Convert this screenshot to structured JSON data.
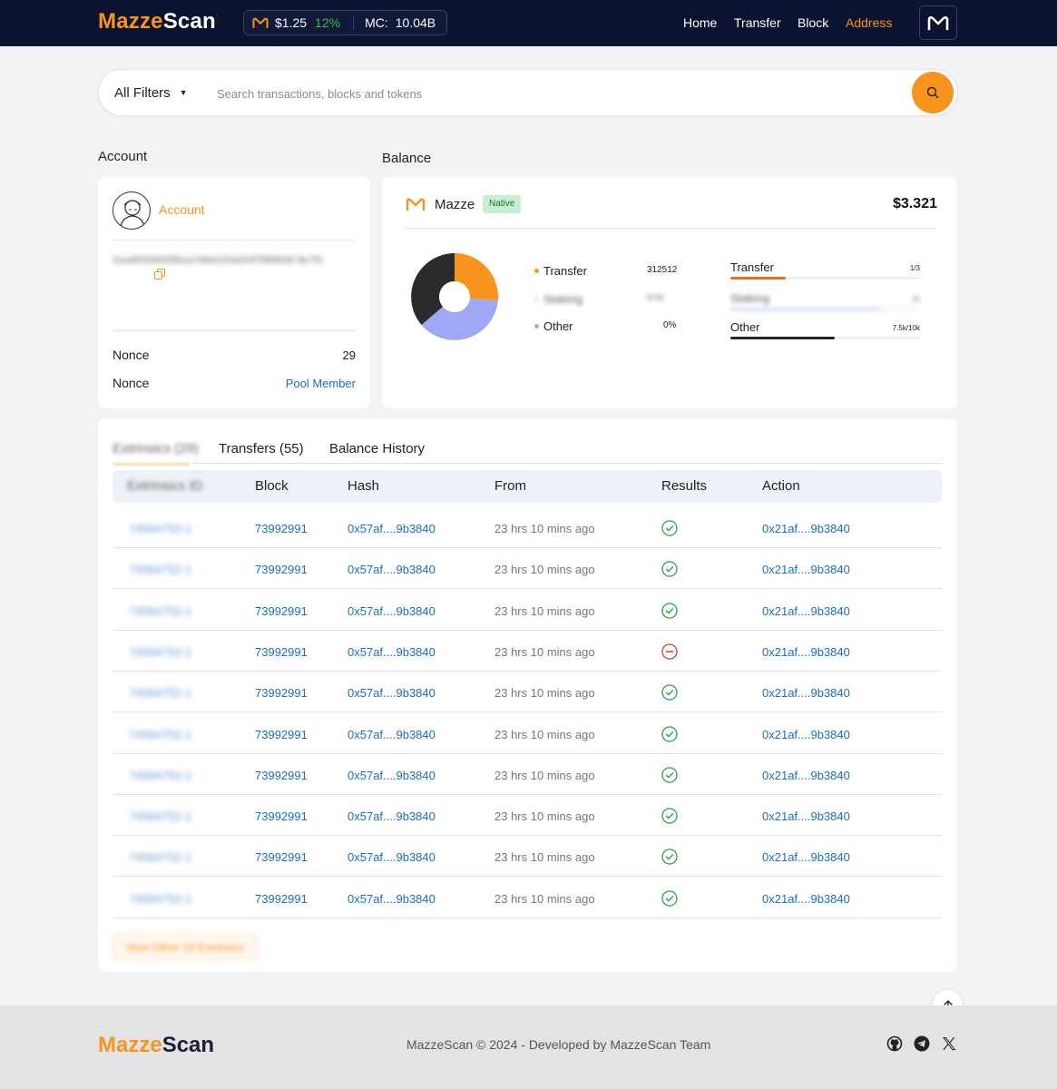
{
  "brand": {
    "part1": "Mazze",
    "part2": "Scan"
  },
  "ticker": {
    "price": "$1.25",
    "change": "12%",
    "mc_label": "MC:",
    "mc_value": "10.04B"
  },
  "nav": {
    "home": "Home",
    "transfer": "Transfer",
    "block": "Block",
    "address": "Address"
  },
  "search": {
    "filter_label": "All Filters",
    "placeholder": "Search transactions, blocks and tokens"
  },
  "account": {
    "section_title": "Account",
    "label": "Account",
    "address": "0xa4f0f39835fbca766e0254d20f7f8f9848 8e7f3",
    "rows": [
      {
        "label": "Nonce",
        "value": "29"
      },
      {
        "label": "Nonce",
        "value": "Pool Member"
      }
    ]
  },
  "balance": {
    "section_title": "Balance",
    "token_name": "Mazze",
    "badge": "Native",
    "amount": "$3.321",
    "legend": [
      {
        "name": "Transfer",
        "value": "312512",
        "color": "#f7941d"
      },
      {
        "name": "Staking",
        "value": "0.01",
        "color": "#c9c9c9"
      },
      {
        "name": "Other",
        "value": "0%",
        "color": "#9fa8f5"
      }
    ],
    "bars": [
      {
        "name": "Transfer",
        "value": "1/3",
        "fraction": 0.29,
        "color": "#f26a1b"
      },
      {
        "name": "Staking",
        "value": "2x",
        "fraction": 0.8,
        "color": "#b7bff5"
      },
      {
        "name": "Other",
        "value": "7.5k/10k",
        "fraction": 0.55,
        "color": "#222222"
      }
    ]
  },
  "tabs": {
    "first": "Extrinsics (29)",
    "transfers": "Transfers (55)",
    "history": "Balance History"
  },
  "table": {
    "headers": {
      "first": "Extrinsics ID",
      "block": "Block",
      "hash": "Hash",
      "from": "From",
      "results": "Results",
      "action": "Action"
    },
    "rows": [
      {
        "id": "74564752-1",
        "block": "73992991",
        "hash": "0x57af....9b3840",
        "time": "23 hrs 10 mins ago",
        "status": "success",
        "action": "0x21af....9b3840"
      },
      {
        "id": "74564752-1",
        "block": "73992991",
        "hash": "0x57af....9b3840",
        "time": "23 hrs 10 mins ago",
        "status": "success",
        "action": "0x21af....9b3840"
      },
      {
        "id": "74564752-1",
        "block": "73992991",
        "hash": "0x57af....9b3840",
        "time": "23 hrs 10 mins ago",
        "status": "success",
        "action": "0x21af....9b3840"
      },
      {
        "id": "74564752-1",
        "block": "73992991",
        "hash": "0x57af....9b3840",
        "time": "23 hrs 10 mins ago",
        "status": "failed",
        "action": "0x21af....9b3840"
      },
      {
        "id": "74564752-1",
        "block": "73992991",
        "hash": "0x57af....9b3840",
        "time": "23 hrs 10 mins ago",
        "status": "success",
        "action": "0x21af....9b3840"
      },
      {
        "id": "74564752-1",
        "block": "73992991",
        "hash": "0x57af....9b3840",
        "time": "23 hrs 10 mins ago",
        "status": "success",
        "action": "0x21af....9b3840"
      },
      {
        "id": "74564752-1",
        "block": "73992991",
        "hash": "0x57af....9b3840",
        "time": "23 hrs 10 mins ago",
        "status": "success",
        "action": "0x21af....9b3840"
      },
      {
        "id": "74564752-1",
        "block": "73992991",
        "hash": "0x57af....9b3840",
        "time": "23 hrs 10 mins ago",
        "status": "success",
        "action": "0x21af....9b3840"
      },
      {
        "id": "74564752-1",
        "block": "73992991",
        "hash": "0x57af....9b3840",
        "time": "23 hrs 10 mins ago",
        "status": "success",
        "action": "0x21af....9b3840"
      },
      {
        "id": "74564752-1",
        "block": "73992991",
        "hash": "0x57af....9b3840",
        "time": "23 hrs 10 mins ago",
        "status": "success",
        "action": "0x21af....9b3840"
      }
    ],
    "view_more": "View Other 19 Extrinsics"
  },
  "footer": {
    "copyright": "MazzeScan © 2024 - Developed by MazzeScan Team"
  },
  "icons": {
    "logo": "mazze-m-icon",
    "search": "search-icon",
    "copy": "copy-icon",
    "success": "check-circle-icon",
    "failed": "minus-circle-icon",
    "scroll_top": "arrow-up-icon",
    "github": "github-icon",
    "telegram": "telegram-icon",
    "x": "x-icon"
  },
  "colors": {
    "accent": "#f7941d",
    "header_bg": "#0c1330",
    "link": "#1b6ec2",
    "success": "#2e9e4f",
    "failed": "#d9363e"
  }
}
